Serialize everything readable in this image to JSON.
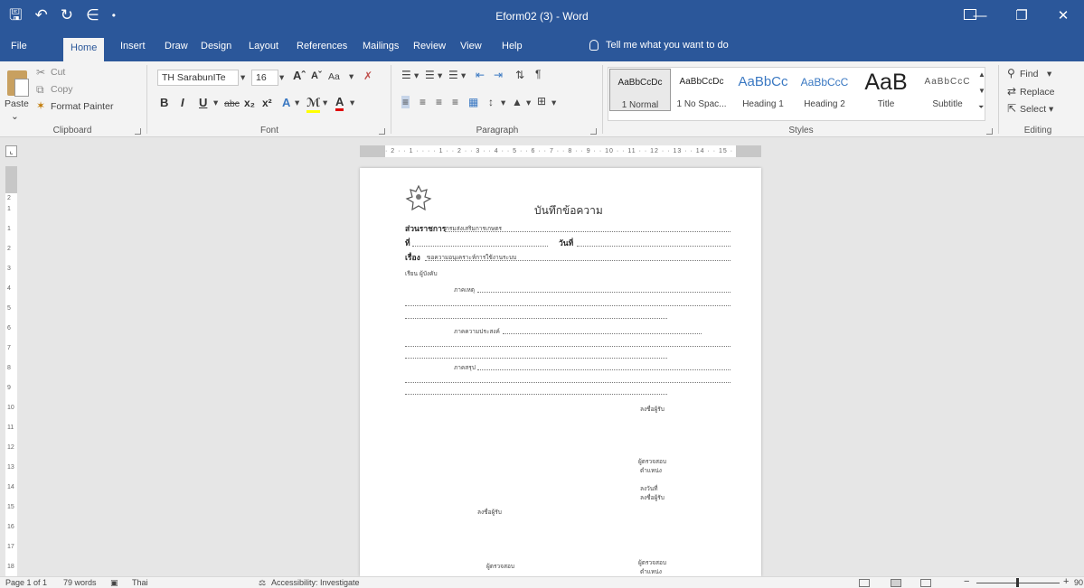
{
  "window": {
    "title": "Eform02 (3)  -  Word",
    "controls": [
      "minimize",
      "restore",
      "close"
    ]
  },
  "qat": {
    "icons": [
      "save-icon",
      "undo-icon",
      "redo-icon",
      "format-painter-icon",
      "customize-icon"
    ]
  },
  "tabs": [
    "File",
    "Home",
    "Insert",
    "Draw",
    "Design",
    "Layout",
    "References",
    "Mailings",
    "Review",
    "View",
    "Help"
  ],
  "tell_me": "Tell me what you want to do",
  "clipboard": {
    "paste": "Paste",
    "cut": "Cut",
    "copy": "Copy",
    "format_painter": "Format Painter",
    "label": "Clipboard"
  },
  "font": {
    "family": "TH SarabunITe",
    "size": "16",
    "aa": "Aa",
    "label": "Font",
    "abc": "abc"
  },
  "paragraph": {
    "label": "Paragraph"
  },
  "styles": {
    "label": "Styles",
    "items": [
      {
        "sample": "AaBbCcDc",
        "name": "1 Normal"
      },
      {
        "sample": "AaBbCcDc",
        "name": "1 No Spac..."
      },
      {
        "sample": "AaBbCc",
        "name": "Heading 1"
      },
      {
        "sample": "AaBbCcC",
        "name": "Heading 2"
      },
      {
        "sample": "AaB",
        "name": "Title"
      },
      {
        "sample": "AaBbCcC",
        "name": "Subtitle"
      }
    ]
  },
  "editing": {
    "find": "Find",
    "replace": "Replace",
    "select": "Select",
    "label": "Editing"
  },
  "ruler": {
    "horizontal": "· 2 · · 1 · · · · 1 · · 2 · · 3 · · 4 · · 5 · · 6 · · 7 · · 8 · · 9 · · 10 · · 11 · · 12 · · 13 · · 14 · · 15 · · 16 · · · · 18",
    "vertical": [
      "2",
      "1",
      "1",
      "2",
      "3",
      "4",
      "5",
      "6",
      "7",
      "8",
      "9",
      "10",
      "11",
      "12",
      "13",
      "14",
      "15",
      "16",
      "17",
      "18"
    ]
  },
  "document": {
    "title": "บันทึกข้อความ",
    "dept_label": "ส่วนราชการ",
    "dept_value": "กรมส่งเสริมการเกษตร",
    "no_label": "ที่",
    "date_label": "วันที่",
    "subject_label": "เรื่อง",
    "subject_value": "ขอความอนุเคราะห์การใช้งานระบบ",
    "to": "เรียน ผู้บังคับ",
    "p1": "ภาคเหตุ",
    "p2": "ภาคความประสงค์",
    "p3": "ภาคสรุป",
    "sig1": "ลงชื่อผู้รับ",
    "sig2a": "ผู้ตรวจสอบ",
    "sig2b": "ตำแหน่ง",
    "sig3a": "ลงวันที่",
    "sig3b": "ลงชื่อผู้รับ",
    "sig_left": "ลงชื่อผู้รับ",
    "sig4a": "ผู้ตรวจสอบ",
    "sig4b": "ตำแหน่ง",
    "sig_left2": "ผู้ตรวจสอบ"
  },
  "status": {
    "page": "Page 1 of 1",
    "words": "79 words",
    "language": "Thai",
    "accessibility": "Accessibility: Investigate",
    "zoom": "90"
  }
}
